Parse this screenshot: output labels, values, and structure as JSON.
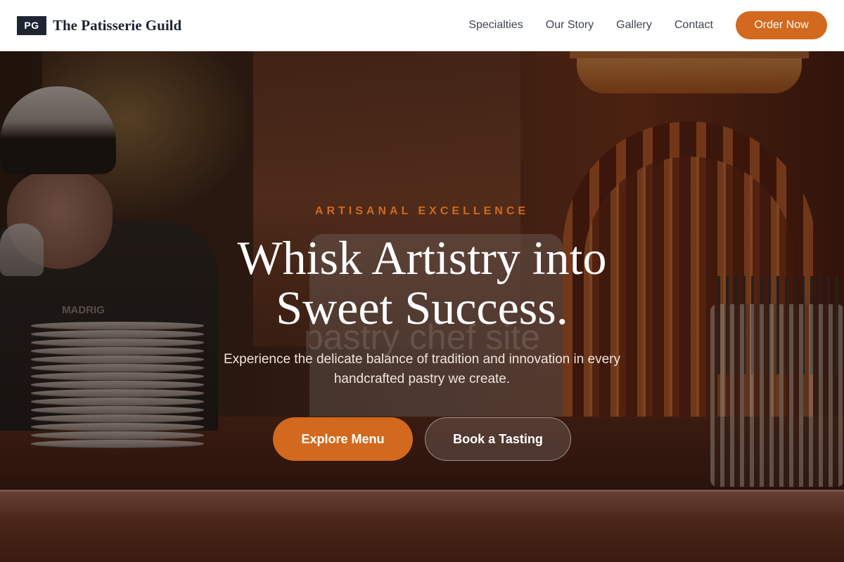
{
  "header": {
    "logo_initials": "PG",
    "brand_name": "The Patisserie Guild",
    "nav": [
      {
        "label": "Specialties"
      },
      {
        "label": "Our Story"
      },
      {
        "label": "Gallery"
      },
      {
        "label": "Contact"
      }
    ],
    "order_label": "Order Now"
  },
  "hero": {
    "eyebrow": "ARTISANAL EXCELLENCE",
    "headline_line1": "Whisk Artistry into",
    "headline_line2": "Sweet Success.",
    "subtitle": "Experience the delicate balance of tradition and innovation in every handcrafted pastry we create.",
    "primary_cta": "Explore Menu",
    "secondary_cta": "Book a Tasting",
    "watermark": "pastry chef site",
    "apron_text": "MADRIG"
  },
  "colors": {
    "accent": "#d2691e",
    "dark": "#1d2533",
    "header_bg": "#ffffff",
    "nav_text": "#3d4452"
  }
}
